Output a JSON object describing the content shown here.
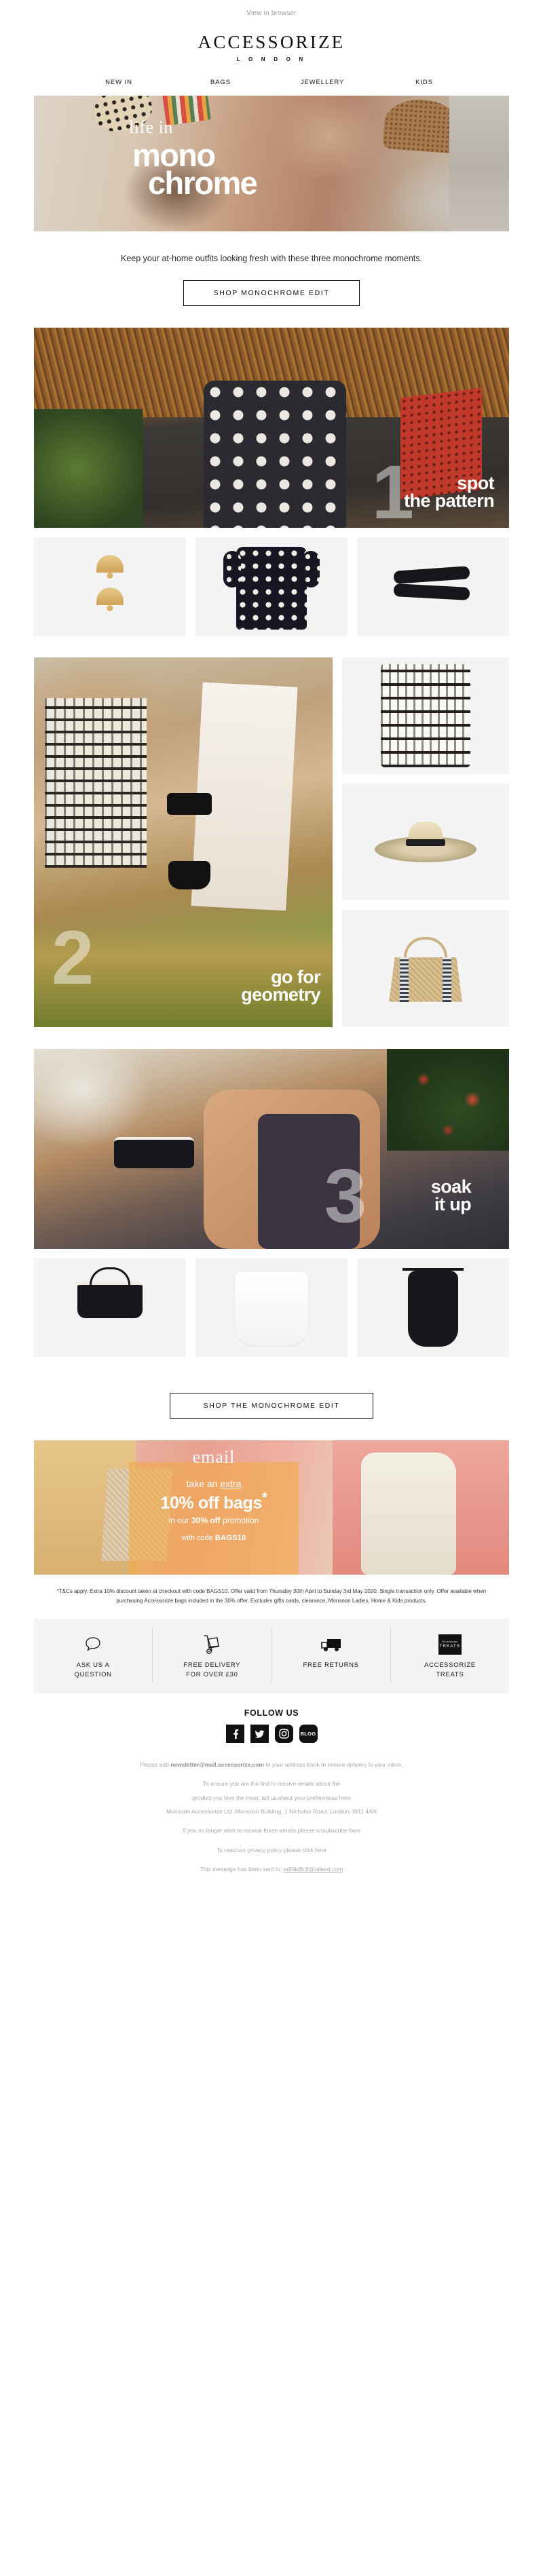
{
  "preheader": {
    "view_in_browser": "View in browser"
  },
  "brand": {
    "name": "ACCESSORIZE",
    "sub": "L O N D O N"
  },
  "nav": {
    "items": [
      {
        "label": "NEW IN"
      },
      {
        "label": "BAGS"
      },
      {
        "label": "JEWELLERY"
      },
      {
        "label": "KIDS"
      }
    ]
  },
  "hero": {
    "line1": "life in",
    "line2": "mono",
    "line3": "chrome"
  },
  "intro": {
    "text": "Keep your at-home outfits looking fresh with these three monochrome moments.",
    "cta": "SHOP MONOCHROME EDIT"
  },
  "features": [
    {
      "number": "1",
      "title_line1": "spot",
      "title_line2": "the pattern",
      "products": [
        {
          "name": "fan-drop-earrings"
        },
        {
          "name": "polka-dot-dress"
        },
        {
          "name": "black-slider-sandals"
        }
      ]
    },
    {
      "number": "2",
      "title_line1": "go for",
      "title_line2": "geometry",
      "products": [
        {
          "name": "aztec-print-dress"
        },
        {
          "name": "straw-fedora-hat"
        },
        {
          "name": "woven-tote-bag"
        }
      ]
    },
    {
      "number": "3",
      "title_line1": "soak",
      "title_line2": "it up",
      "products": [
        {
          "name": "black-bikini-top"
        },
        {
          "name": "white-beach-cover-up"
        },
        {
          "name": "black-swimsuit"
        }
      ]
    }
  ],
  "shop_edit_cta": "SHOP THE MONOCHROME EDIT",
  "promo": {
    "script_word": "email",
    "line_take": "take an ",
    "line_take_underline": "extra",
    "headline": "10% off bags",
    "headline_star": "*",
    "sub_prefix": "in our ",
    "sub_bold": "30% off",
    "sub_suffix": " promotion",
    "code_prefix": "with code ",
    "code": "BAGS10"
  },
  "terms": {
    "text": "*T&Cs apply.  Extra 10% discount taken at checkout with code BAGS10. Offer valid from Thursday 30th April to Sunday 3rd May 2020. Single transaction only. Offer available when purchasing Accessorize bags included in the 30% offer. Excludes gifts cards, clearance, Monsoon Ladies, Home & Kids products."
  },
  "services": [
    {
      "icon": "speech-bubble-icon",
      "label_line1": "ASK US A",
      "label_line2": "QUESTION"
    },
    {
      "icon": "delivery-trolley-icon",
      "label_line1": "FREE DELIVERY",
      "label_line2": "FOR OVER £30"
    },
    {
      "icon": "truck-icon",
      "label_line1": "FREE RETURNS",
      "label_line2": ""
    },
    {
      "icon": "treats-badge-icon",
      "label_line1": "ACCESSORIZE",
      "label_line2": "TREATS",
      "badge_top": "Accessorize",
      "badge_bottom": "TREATS"
    }
  ],
  "follow": {
    "title": "FOLLOW US",
    "socials": [
      {
        "name": "facebook-icon",
        "glyph": "f"
      },
      {
        "name": "twitter-icon",
        "glyph": ""
      },
      {
        "name": "instagram-icon",
        "glyph": ""
      },
      {
        "name": "blog-icon",
        "glyph": "BLOG"
      }
    ]
  },
  "footer": {
    "line1_prefix": "Please add ",
    "line1_email": "newsletter@mail.accessorize.com",
    "line1_suffix": " to your address book to ensure delivery to your inbox.",
    "line2": "To ensure you are the first to receive emails about the",
    "line3": "product you love the most, tell us about your preferences here",
    "line4": "Monsoon Accessorize Ltd, Monsoon Building, 1 Nicholas Road, London, W11 4AN",
    "line5": "If you no longer wish to receive these emails please unsubscribe here",
    "line6": "To read our privacy policy please click here",
    "line7_prefix": "This message has been sent to: ",
    "line7_email": "ed59d8c8@uifeed.com"
  },
  "colors": {
    "accent_promo": "#f3aa46",
    "text": "#1a1a1a",
    "muted": "#a8a8a8",
    "tile_bg": "#f4f4f4"
  }
}
